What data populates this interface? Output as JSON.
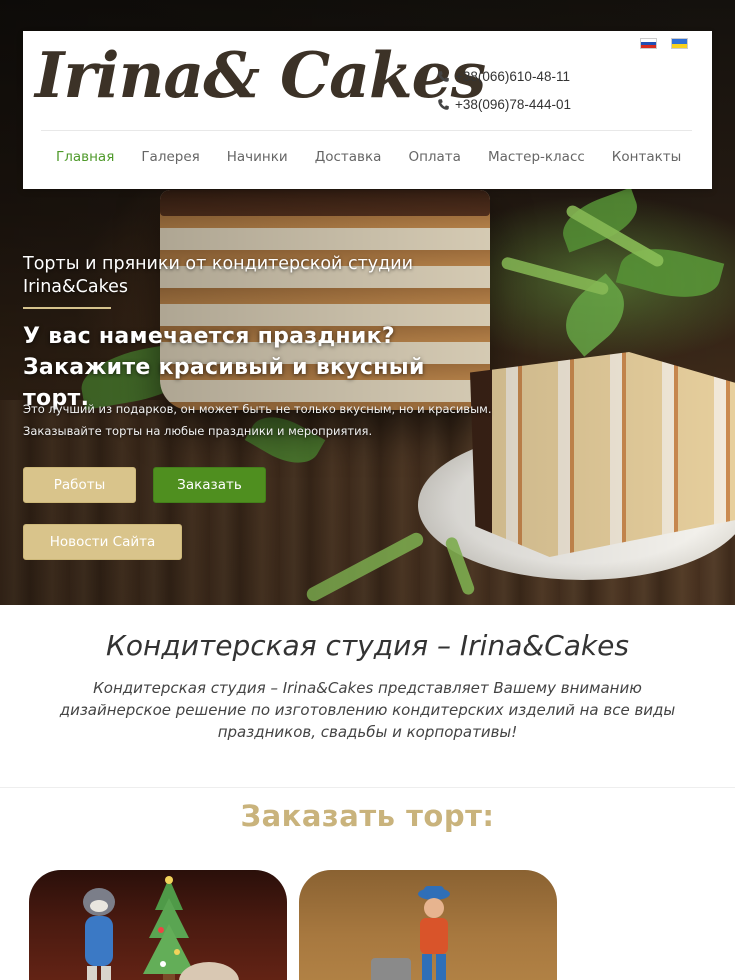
{
  "brand": {
    "logo": "Irina& Cakes"
  },
  "header": {
    "phones": [
      "+38(066)610-48-11",
      "+38(096)78-444-01"
    ],
    "languages": [
      "ru",
      "ua"
    ]
  },
  "nav": {
    "items": [
      "Главная",
      "Галерея",
      "Начинки",
      "Доставка",
      "Оплата",
      "Мастер-класс",
      "Контакты"
    ],
    "active": "Главная"
  },
  "hero": {
    "subtitle": "Торты и пряники от кондитерской студии Irina&Cakes",
    "title_line1": "У вас намечается праздник?",
    "title_line2": "Закажите красивый и вкусный торт.",
    "description_line1": "Это лучший из подарков, он может быть не только вкусным, но и красивым.",
    "description_line2": "Заказывайте торты на любые праздники и мероприятия.",
    "buttons": {
      "works": "Работы",
      "order": "Заказать",
      "news": "Новости Сайта"
    }
  },
  "studio": {
    "title": "Кондитерская студия – Irina&Cakes",
    "text": "Кондитерская студия – Irina&Cakes представляет Вашему вниманию дизайнерское решение по изготовлению кондитерских изделий на все виды праздников, свадьбы и корпоративы!"
  },
  "order": {
    "title": "Заказать торт:"
  },
  "colors": {
    "accent_green": "#4f9a2b",
    "button_gold": "#d9c48b",
    "button_green": "#4f8f1f",
    "order_title": "#c9b37c"
  },
  "icons": [
    "phone-icon",
    "flag-ru-icon",
    "flag-ua-icon"
  ]
}
